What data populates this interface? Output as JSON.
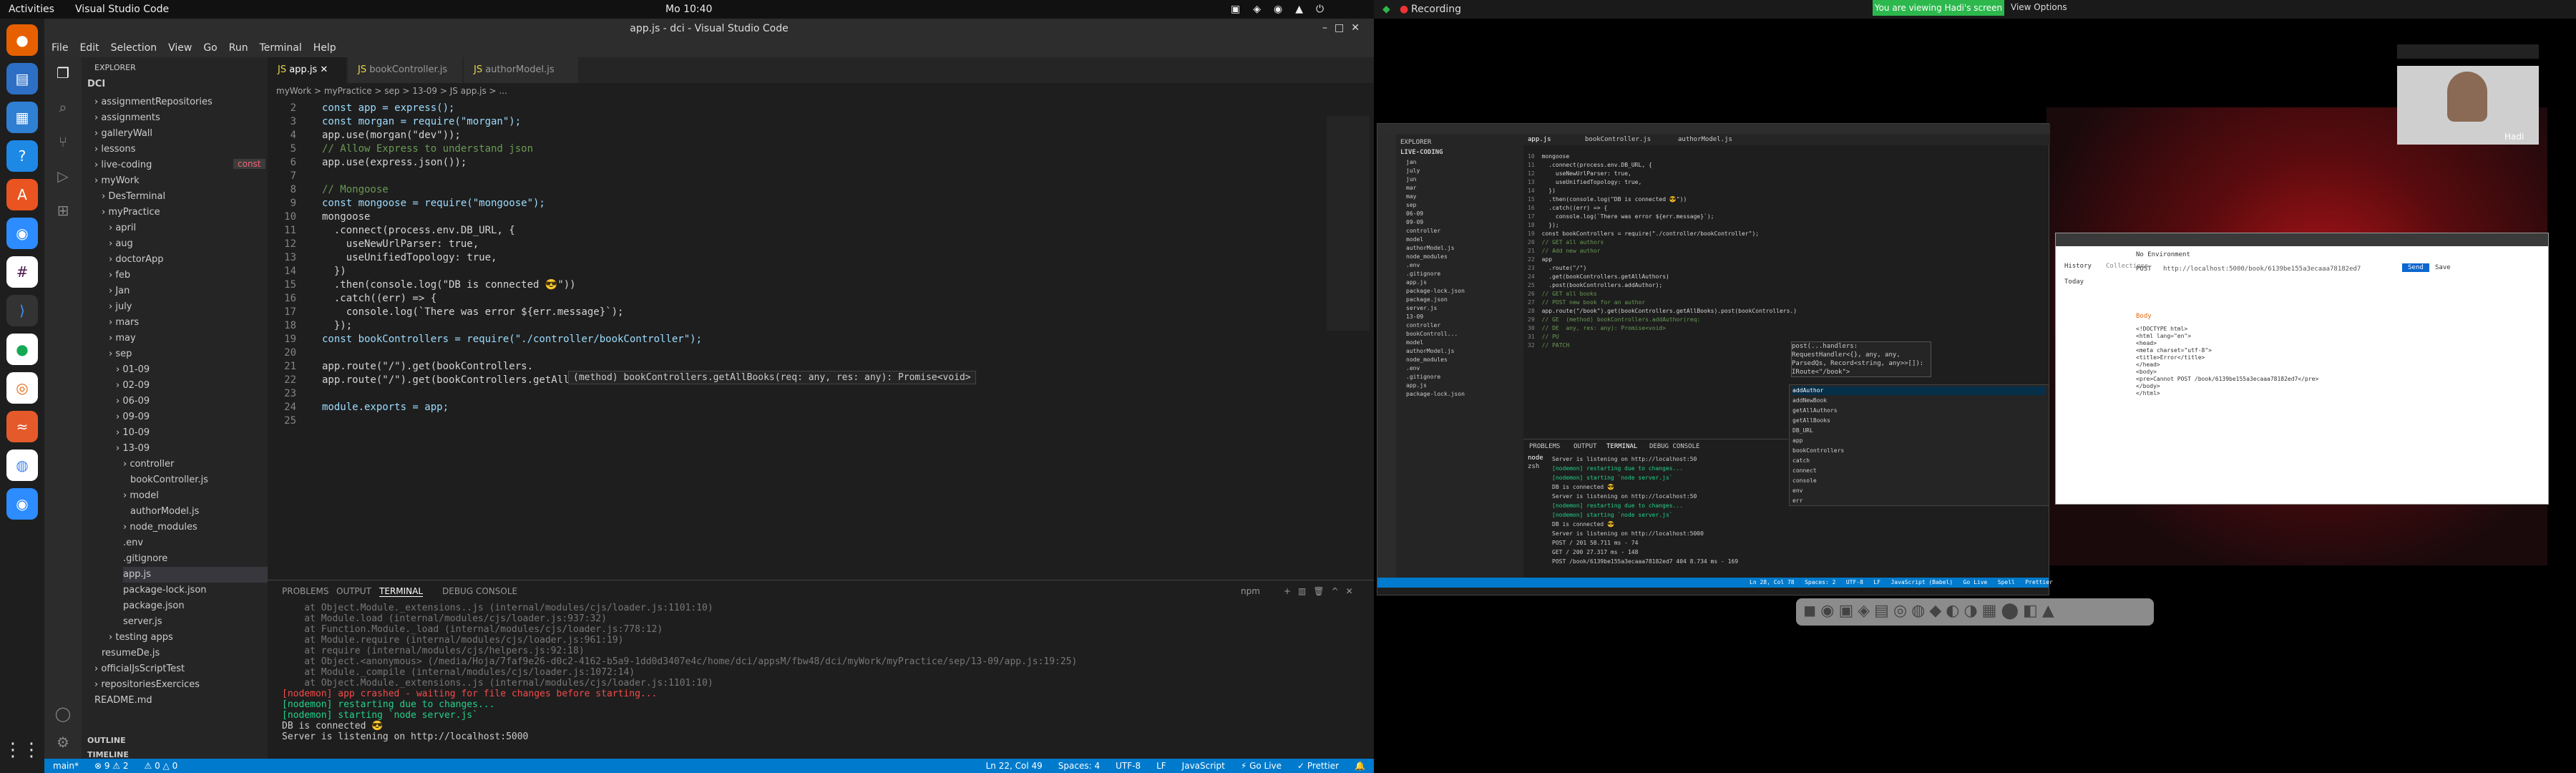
{
  "gnome": {
    "activities": "Activities",
    "app": "Visual Studio Code",
    "clock": "Mo 10:40"
  },
  "vscode": {
    "title": "app.js - dci - Visual Studio Code",
    "menu": [
      "File",
      "Edit",
      "Selection",
      "View",
      "Go",
      "Run",
      "Terminal",
      "Help"
    ],
    "explorer_title": "EXPLORER",
    "root": "DCI",
    "tree": [
      {
        "label": "assignmentRepositories",
        "depth": 1,
        "type": "folder"
      },
      {
        "label": "assignments",
        "depth": 1,
        "type": "folder"
      },
      {
        "label": "galleryWall",
        "depth": 1,
        "type": "folder"
      },
      {
        "label": "lessons",
        "depth": 1,
        "type": "folder"
      },
      {
        "label": "live-coding",
        "depth": 1,
        "type": "folder"
      },
      {
        "label": "myWork",
        "depth": 1,
        "type": "folder"
      },
      {
        "label": "DesTerminal",
        "depth": 2,
        "type": "folder"
      },
      {
        "label": "myPractice",
        "depth": 2,
        "type": "folder"
      },
      {
        "label": "april",
        "depth": 3,
        "type": "folder"
      },
      {
        "label": "aug",
        "depth": 3,
        "type": "folder"
      },
      {
        "label": "doctorApp",
        "depth": 3,
        "type": "folder"
      },
      {
        "label": "feb",
        "depth": 3,
        "type": "folder"
      },
      {
        "label": "Jan",
        "depth": 3,
        "type": "folder"
      },
      {
        "label": "july",
        "depth": 3,
        "type": "folder"
      },
      {
        "label": "mars",
        "depth": 3,
        "type": "folder"
      },
      {
        "label": "may",
        "depth": 3,
        "type": "folder"
      },
      {
        "label": "sep",
        "depth": 3,
        "type": "folder"
      },
      {
        "label": "01-09",
        "depth": 4,
        "type": "folder"
      },
      {
        "label": "02-09",
        "depth": 4,
        "type": "folder"
      },
      {
        "label": "06-09",
        "depth": 4,
        "type": "folder"
      },
      {
        "label": "09-09",
        "depth": 4,
        "type": "folder"
      },
      {
        "label": "10-09",
        "depth": 4,
        "type": "folder"
      },
      {
        "label": "13-09",
        "depth": 4,
        "type": "folder"
      },
      {
        "label": "controller",
        "depth": 5,
        "type": "folder"
      },
      {
        "label": "bookController.js",
        "depth": 6,
        "type": "file"
      },
      {
        "label": "model",
        "depth": 5,
        "type": "folder"
      },
      {
        "label": "authorModel.js",
        "depth": 6,
        "type": "file"
      },
      {
        "label": "node_modules",
        "depth": 5,
        "type": "folder"
      },
      {
        "label": ".env",
        "depth": 5,
        "type": "file"
      },
      {
        "label": ".gitignore",
        "depth": 5,
        "type": "file"
      },
      {
        "label": "app.js",
        "depth": 5,
        "type": "file"
      },
      {
        "label": "package-lock.json",
        "depth": 5,
        "type": "file"
      },
      {
        "label": "package.json",
        "depth": 5,
        "type": "file"
      },
      {
        "label": "server.js",
        "depth": 5,
        "type": "file"
      },
      {
        "label": "testing apps",
        "depth": 3,
        "type": "folder"
      },
      {
        "label": "resumeDe.js",
        "depth": 2,
        "type": "file"
      },
      {
        "label": "officialJsScriptTest",
        "depth": 1,
        "type": "folder"
      },
      {
        "label": "repositoriesExercices",
        "depth": 1,
        "type": "folder"
      },
      {
        "label": "README.md",
        "depth": 1,
        "type": "file"
      }
    ],
    "outline": "OUTLINE",
    "timeline": "TIMELINE",
    "const_hint": "const",
    "tabs": [
      "app.js",
      "bookController.js",
      "authorModel.js"
    ],
    "breadcrumb": "myWork > myPractice > sep > 13-09 > JS app.js > ...",
    "code_lines": [
      {
        "n": "2",
        "t": "const app = express();"
      },
      {
        "n": "3",
        "t": "const morgan = require(\"morgan\");"
      },
      {
        "n": "4",
        "t": "app.use(morgan(\"dev\"));"
      },
      {
        "n": "5",
        "t": "// Allow Express to understand json"
      },
      {
        "n": "6",
        "t": "app.use(express.json());"
      },
      {
        "n": "7",
        "t": ""
      },
      {
        "n": "8",
        "t": "// Mongoose"
      },
      {
        "n": "9",
        "t": "const mongoose = require(\"mongoose\");"
      },
      {
        "n": "10",
        "t": "mongoose"
      },
      {
        "n": "11",
        "t": "  .connect(process.env.DB_URL, {"
      },
      {
        "n": "12",
        "t": "    useNewUrlParser: true,"
      },
      {
        "n": "13",
        "t": "    useUnifiedTopology: true,"
      },
      {
        "n": "14",
        "t": "  })"
      },
      {
        "n": "15",
        "t": "  .then(console.log(\"DB is connected 😎\"))"
      },
      {
        "n": "16",
        "t": "  .catch((err) => {"
      },
      {
        "n": "17",
        "t": "    console.log(`There was error ${err.message}`);"
      },
      {
        "n": "18",
        "t": "  });"
      },
      {
        "n": "19",
        "t": "const bookControllers = require(\"./controller/bookController\");"
      },
      {
        "n": "20",
        "t": ""
      },
      {
        "n": "21",
        "t": "app.route(\"/\").get(bookControllers."
      },
      {
        "n": "22",
        "t": "app.route(\"/\").get(bookControllers.getAllBooks);"
      },
      {
        "n": "23",
        "t": ""
      },
      {
        "n": "24",
        "t": "module.exports = app;"
      },
      {
        "n": "25",
        "t": ""
      }
    ],
    "hover_tip": "(method) bookControllers.getAllBooks(req: any, res: any): Promise<void>",
    "panel_tabs": [
      "PROBLEMS",
      "OUTPUT",
      "TERMINAL",
      "DEBUG CONSOLE"
    ],
    "terminal_shell": "npm",
    "terminal_lines": [
      "    at Object.Module._extensions..js (internal/modules/cjs/loader.js:1101:10)",
      "    at Module.load (internal/modules/cjs/loader.js:937:32)",
      "    at Function.Module._load (internal/modules/cjs/loader.js:778:12)",
      "    at Module.require (internal/modules/cjs/loader.js:961:19)",
      "    at require (internal/modules/cjs/helpers.js:92:18)",
      "    at Object.<anonymous> (/media/Hoja/7faf9e26-d0c2-4162-b5a9-1dd0d3407e4c/home/dci/appsM/fbw48/dci/myWork/myPractice/sep/13-09/app.js:19:25)",
      "    at Module._compile (internal/modules/cjs/loader.js:1072:14)",
      "    at Object.Module._extensions..js (internal/modules/cjs/loader.js:1101:10)",
      "[nodemon] app crashed - waiting for file changes before starting...",
      "[nodemon] restarting due to changes...",
      "[nodemon] starting `node server.js`",
      "DB is connected 😎",
      "Server is listening on http://localhost:5000",
      ""
    ],
    "status_left": [
      "main*",
      "⊗ 9 ⚠ 2",
      "⚠ 0 △ 0"
    ],
    "status_right": [
      "Ln 22, Col 49",
      "Spaces: 4",
      "UTF-8",
      "LF",
      "JavaScript",
      "⚡ Go Live",
      "✓ Prettier"
    ]
  },
  "zoom": {
    "recording": "Recording",
    "sharing_banner": "You are viewing Hadi's screen",
    "view_options": "View Options",
    "participant": "Hadi"
  },
  "shared_vscode": {
    "explorer": "EXPLORER",
    "root": "LIVE-CODING",
    "tree": [
      "jan",
      "july",
      "jun",
      "mar",
      "may",
      "sep",
      "06-09",
      "09-09",
      "controller",
      "model",
      "authorModel.js",
      "node_modules",
      ".env",
      ".gitignore",
      "app.js",
      "package-lock.json",
      "package.json",
      "server.js",
      "13-09",
      "controller",
      "bookControll...",
      "model",
      "authorModel.js",
      "node_modules",
      ".env",
      ".gitignore",
      "app.js",
      "package-lock.json"
    ],
    "tabs": [
      "app.js",
      "bookController.js",
      "authorModel.js"
    ],
    "code": [
      {
        "n": "10",
        "t": "mongoose"
      },
      {
        "n": "11",
        "t": "  .connect(process.env.DB_URL, {"
      },
      {
        "n": "12",
        "t": "    useNewUrlParser: true,"
      },
      {
        "n": "13",
        "t": "    useUnifiedTopology: true,"
      },
      {
        "n": "14",
        "t": "  })"
      },
      {
        "n": "15",
        "t": "  .then(console.log(\"DB is connected 😎\"))"
      },
      {
        "n": "16",
        "t": "  .catch((err) => {"
      },
      {
        "n": "17",
        "t": "    console.log(`There was error ${err.message}`);"
      },
      {
        "n": "18",
        "t": "  });"
      },
      {
        "n": "19",
        "t": "const bookControllers = require(\"./controller/bookController\");"
      },
      {
        "n": "20",
        "t": "// GET all authors"
      },
      {
        "n": "21",
        "t": "// Add new author"
      },
      {
        "n": "22",
        "t": "app"
      },
      {
        "n": "23",
        "t": "  .route(\"/\")"
      },
      {
        "n": "24",
        "t": "  .get(bookControllers.getAllAuthors)"
      },
      {
        "n": "25",
        "t": "  .post(bookControllers.addAuthor);"
      },
      {
        "n": "26",
        "t": "// GET all books"
      },
      {
        "n": "27",
        "t": "// POST new book for an author"
      },
      {
        "n": "28",
        "t": "app.route(\"/book\").get(bookControllers.getAllBooks).post(bookControllers.)"
      },
      {
        "n": "29",
        "t": "// GE  (method) bookControllers.addAuthor(req:"
      },
      {
        "n": "30",
        "t": "// DE  any, res: any): Promise<void>"
      },
      {
        "n": "31",
        "t": "// PU"
      },
      {
        "n": "32",
        "t": "// PATCH"
      }
    ],
    "signature": "post(...handlers: RequestHandler<{}, any, any, ParsedQs, Record<string, any>>[]): IRoute<\"/book\">",
    "suggestions": [
      "addAuthor",
      "addNewBook",
      "getAllAuthors",
      "getAllBooks",
      "DB_URL",
      "app",
      "bookControllers",
      "catch",
      "connect",
      "console",
      "env",
      "err"
    ],
    "panel_tabs": [
      "PROBLEMS",
      "OUTPUT",
      "TERMINAL",
      "DEBUG CONSOLE"
    ],
    "term_side": [
      "node",
      "zsh"
    ],
    "terminal": [
      "Server is listening on http://localhost:50",
      "[nodemon] restarting due to changes...",
      "[nodemon] starting `node server.js`",
      "DB is connected 😎",
      "Server is listening on http://localhost:50",
      "[nodemon] restarting due to changes...",
      "[nodemon] starting `node server.js`",
      "DB is connected 😎",
      "Server is listening on http://localhost:5000",
      "POST / 201 58.711 ms - 74",
      "GET / 200 27.317 ms - 148",
      "POST /book/6139be155a3ecaaa78182ed7 404 8.734 ms - 169"
    ],
    "status": "Ln 28, Col 78   Spaces: 2   UTF-8   LF   JavaScript (Babel)   Go Live   Spell   Prettier"
  },
  "postman": {
    "send": "Send",
    "save": "Save",
    "method": "POST",
    "url": "http://localhost:5000/book/6139be155a3ecaaa78182ed7",
    "no_env": "No Environment",
    "history": "History",
    "collections": "Collections",
    "today": "Today",
    "body_tab": "Body",
    "response_lines": [
      "<!DOCTYPE html>",
      "<html lang=\"en\">",
      "<head>",
      "<meta charset=\"utf-8\">",
      "<title>Error</title>",
      "</head>",
      "<body>",
      "<pre>Cannot POST /book/6139be155a3ecaaa78182ed7</pre>",
      "</body>",
      "</html>"
    ]
  }
}
